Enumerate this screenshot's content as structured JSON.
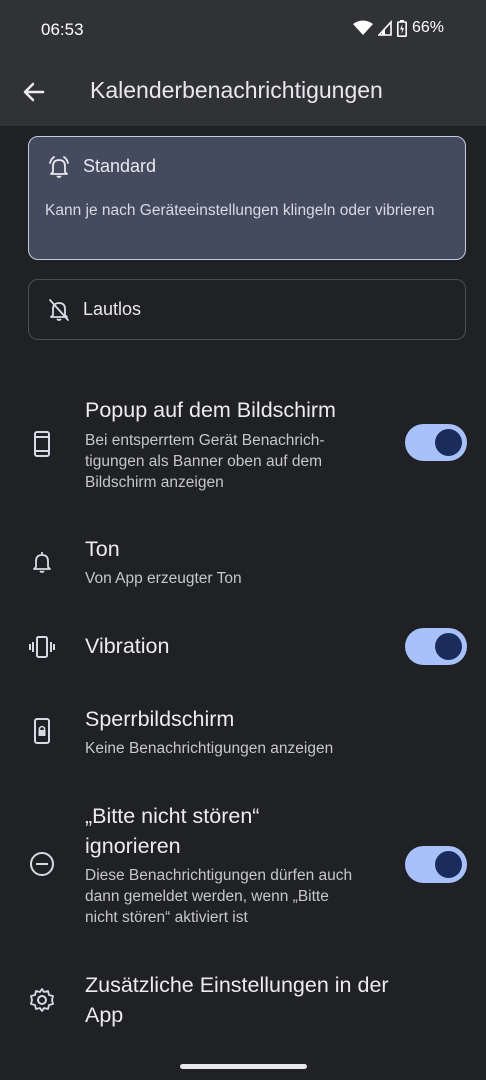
{
  "status": {
    "time": "06:53",
    "battery": "66%",
    "icons": [
      "wifi-icon",
      "signal-icon",
      "battery-icon"
    ]
  },
  "appbar": {
    "title": "Kalenderbenachrichtigungen",
    "back_icon": "arrow-back-icon"
  },
  "modes": {
    "standard": {
      "label": "Standard",
      "description": "Kann je nach Geräteeinstellungen klingeln oder vibrieren",
      "selected": true
    },
    "silent": {
      "label": "Lautlos",
      "selected": false
    }
  },
  "settings": {
    "popup": {
      "title": "Popup auf dem Bildschirm",
      "subtitle": "Bei entsperrtem Gerät Benachrich-tigungen als Banner oben auf dem Bildschirm anzeigen",
      "subtitle_lines": [
        "Bei entsperrtem Gerät Benachrich-",
        "tigungen als Banner oben auf dem",
        "Bildschirm anzeigen"
      ],
      "enabled": true
    },
    "sound": {
      "title": "Ton",
      "subtitle": "Von App erzeugter Ton"
    },
    "vibration": {
      "title": "Vibration",
      "enabled": true
    },
    "lockscreen": {
      "title": "Sperrbildschirm",
      "subtitle": "Keine Benachrichtigungen anzeigen"
    },
    "dnd": {
      "title_line1": "„Bitte nicht stören“",
      "title_line2": "ignorieren",
      "subtitle_lines": [
        "Diese Benachrichtigungen dürfen auch",
        "dann gemeldet werden, wenn „Bitte",
        "nicht stören“ aktiviert ist"
      ],
      "enabled": true
    },
    "additional": {
      "title_line1": "Zusätzliche Einstellungen in der",
      "title_line2": "App"
    }
  },
  "colors": {
    "background": "#202124",
    "appbar": "#303236",
    "selected_card": "#454b5e",
    "toggle_track": "#a9c1fb",
    "toggle_thumb": "#1a2c5c"
  }
}
